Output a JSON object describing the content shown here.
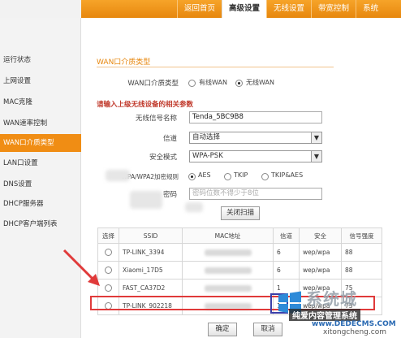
{
  "nav": {
    "tabs": [
      "返回首页",
      "高级设置",
      "无线设置",
      "带宽控制",
      "系统"
    ],
    "active_index": 1
  },
  "sidebar": {
    "items": [
      {
        "label": "运行状态"
      },
      {
        "label": "上网设置"
      },
      {
        "label": "MAC克隆"
      },
      {
        "label": "WAN速率控制"
      },
      {
        "label": "WAN口介质类型"
      },
      {
        "label": "LAN口设置"
      },
      {
        "label": "DNS设置"
      },
      {
        "label": "DHCP服务器"
      },
      {
        "label": "DHCP客户端列表"
      }
    ],
    "active_index": 4
  },
  "form": {
    "section_title": "WAN口介质类型",
    "media_type_label": "WAN口介质类型",
    "media_wired": "有线WAN",
    "media_wireless": "无线WAN",
    "media_selected": "无线WAN",
    "warning": "请输入上级无线设备的相关参数",
    "ssid_label": "无线信号名称",
    "ssid_value": "Tenda_5BC9B8",
    "channel_label": "信道",
    "channel_value": "自动选择",
    "security_label": "安全模式",
    "security_value": "WPA-PSK",
    "encryption_label": "WPA/WPA2加密规则",
    "enc_aes": "AES",
    "enc_tkip": "TKIP",
    "enc_tkipaes": "TKIP&AES",
    "enc_selected": "AES",
    "password_label": "密码",
    "password_placeholder": "密码位数不得少于8位",
    "scan_close_button": "关闭扫描"
  },
  "table": {
    "headers": [
      "选择",
      "SSID",
      "MAC地址",
      "信道",
      "安全",
      "信号强度"
    ],
    "rows": [
      {
        "ssid": "TP-LINK_3394",
        "channel": "6",
        "security": "wep/wpa",
        "signal": "88"
      },
      {
        "ssid": "Xiaomi_17D5",
        "channel": "6",
        "security": "wep/wpa",
        "signal": "88"
      },
      {
        "ssid": "FAST_CA37D2",
        "channel": "1",
        "security": "wep/wpa",
        "signal": "75"
      },
      {
        "ssid": "TP-LINK_902218",
        "channel": "1",
        "security": "wep/wpa",
        "signal": "73"
      }
    ],
    "highlighted_row": 2
  },
  "buttons": {
    "ok": "确定",
    "cancel": "取消"
  },
  "watermark": {
    "title": "系统城",
    "band": "纯爱内容管理系统",
    "url1": "www.DEDECMS.COM",
    "url2": "xitongcheng.com"
  },
  "colors": {
    "accent": "#f08d14",
    "warning": "#c0392b",
    "highlight_row": "#e03a3a",
    "highlight_cell": "#3b3fa8"
  }
}
